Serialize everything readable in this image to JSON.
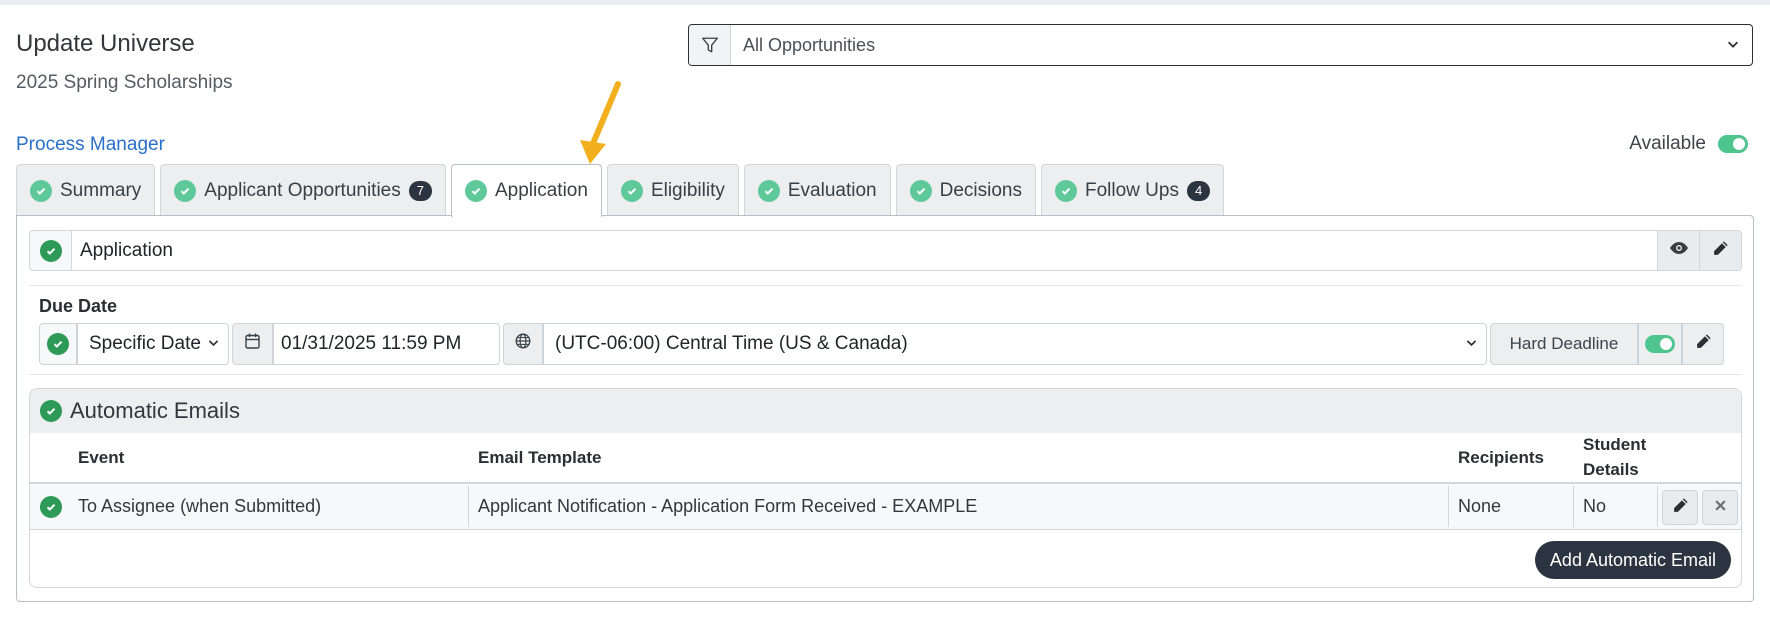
{
  "header": {
    "title": "Update Universe",
    "subtitle": "2025 Spring Scholarships"
  },
  "filter": {
    "icon": "filter-icon",
    "selected": "All Opportunities"
  },
  "process_manager_link": "Process Manager",
  "available": {
    "label": "Available",
    "enabled": true
  },
  "tabs": [
    {
      "label": "Summary",
      "badge": ""
    },
    {
      "label": "Applicant Opportunities",
      "badge": "7"
    },
    {
      "label": "Application",
      "badge": "",
      "active": true
    },
    {
      "label": "Eligibility",
      "badge": ""
    },
    {
      "label": "Evaluation",
      "badge": ""
    },
    {
      "label": "Decisions",
      "badge": ""
    },
    {
      "label": "Follow Ups",
      "badge": "4"
    }
  ],
  "application": {
    "name": "Application"
  },
  "due_date": {
    "label": "Due Date",
    "type": "Specific Date",
    "datetime": "01/31/2025 11:59 PM",
    "timezone": "(UTC-06:00) Central Time (US & Canada)",
    "hard_deadline_label": "Hard Deadline",
    "hard_deadline_enabled": true
  },
  "automatic_emails": {
    "title": "Automatic Emails",
    "columns": {
      "event": "Event",
      "template": "Email Template",
      "recipients": "Recipients",
      "student_details_1": "Student",
      "student_details_2": "Details"
    },
    "rows": [
      {
        "event": "To Assignee (when Submitted)",
        "template": "Applicant Notification - Application Form Received - EXAMPLE",
        "recipients": "None",
        "student_details": "No"
      }
    ],
    "add_button": "Add Automatic Email"
  },
  "colors": {
    "accent_green": "#2e9a58",
    "toggle_green": "#4fc48c",
    "link_blue": "#2a6fc9",
    "dark_button": "#2b3440",
    "annotation_arrow": "#f2b01e"
  }
}
